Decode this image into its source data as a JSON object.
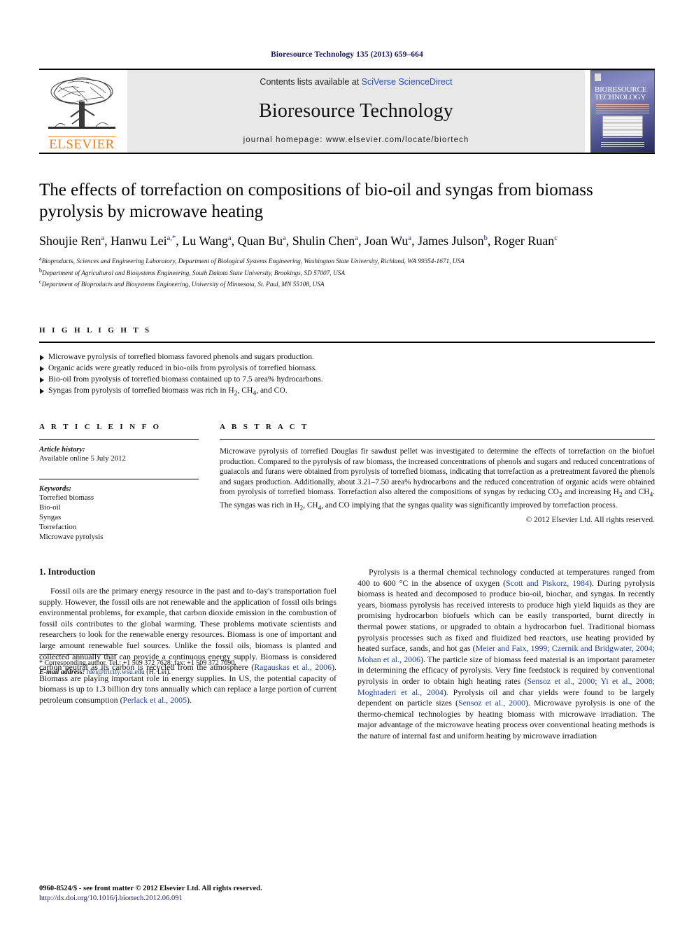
{
  "running_head": "Bioresource Technology 135 (2013) 659–664",
  "masthead": {
    "publisher_logo_text": "ELSEVIER",
    "contents_prefix": "Contents lists available at ",
    "contents_link": "SciVerse ScienceDirect",
    "journal_title": "Bioresource Technology",
    "homepage_line": "journal homepage: www.elsevier.com/locate/biortech",
    "cover_title_line1": "BIORESOURCE",
    "cover_title_line2": "TECHNOLOGY"
  },
  "article": {
    "title": "The effects of torrefaction on compositions of bio-oil and syngas from biomass pyrolysis by microwave heating",
    "authors": [
      {
        "name": "Shoujie Ren",
        "sup": "a"
      },
      {
        "name": "Hanwu Lei",
        "sup": "a,*"
      },
      {
        "name": "Lu Wang",
        "sup": "a"
      },
      {
        "name": "Quan Bu",
        "sup": "a"
      },
      {
        "name": "Shulin Chen",
        "sup": "a"
      },
      {
        "name": "Joan Wu",
        "sup": "a"
      },
      {
        "name": "James Julson",
        "sup": "b"
      },
      {
        "name": "Roger Ruan",
        "sup": "c"
      }
    ],
    "affiliations": [
      {
        "sup": "a",
        "text": "Bioproducts, Sciences and Engineering Laboratory, Department of Biological Systems Engineering, Washington State University, Richland, WA 99354-1671, USA"
      },
      {
        "sup": "b",
        "text": "Department of Agricultural and Biosystems Engineering, South Dakota State University, Brookings, SD 57007, USA"
      },
      {
        "sup": "c",
        "text": "Department of Bioproducts and Biosystems Engineering, University of Minnesota, St. Paul, MN 55108, USA"
      }
    ]
  },
  "highlights": {
    "label": "H I G H L I G H T S",
    "items": [
      "Microwave pyrolysis of torrefied biomass favored phenols and sugars production.",
      "Organic acids were greatly reduced in bio-oils from pyrolysis of torrefied biomass.",
      "Bio-oil from pyrolysis of torrefied biomass contained up to 7.5 area% hydrocarbons.",
      "Syngas from pyrolysis of torrefied biomass was rich in H2, CH4, and CO."
    ]
  },
  "article_info": {
    "label": "A R T I C L E    I N F O",
    "history_label": "Article history:",
    "history_value": "Available online 5 July 2012",
    "keywords_label": "Keywords:",
    "keywords": [
      "Torrefied biomass",
      "Bio-oil",
      "Syngas",
      "Torrefaction",
      "Microwave pyrolysis"
    ]
  },
  "abstract": {
    "label": "A B S T R A C T",
    "text": "Microwave pyrolysis of torrefied Douglas fir sawdust pellet was investigated to determine the effects of torrefaction on the biofuel production. Compared to the pyrolysis of raw biomass, the increased concentrations of phenols and sugars and reduced concentrations of guaiacols and furans were obtained from pyrolysis of torrefied biomass, indicating that torrefaction as a pretreatment favored the phenols and sugars production. Additionally, about 3.21–7.50 area% hydrocarbons and the reduced concentration of organic acids were obtained from pyrolysis of torrefied biomass. Torrefaction also altered the compositions of syngas by reducing CO2 and increasing H2 and CH4. The syngas was rich in H2, CH4, and CO implying that the syngas quality was significantly improved by torrefaction process.",
    "copyright": "© 2012 Elsevier Ltd. All rights reserved."
  },
  "introduction": {
    "heading": "1. Introduction",
    "left_paragraph_1_part1": "Fossil oils are the primary energy resource in the past and to-day's transportation fuel supply. However, the fossil oils are not renewable and the application of fossil oils brings environmental problems, for example, that carbon dioxide emission in the combustion of fossil oils contributes to the global warming. These problems motivate scientists and researchers to look for the renewable energy resources. Biomass is one of important and large amount renewable fuel sources. Unlike the fossil oils, biomass is planted and collected annually that can provide a continuous energy supply. Biomass is considered carbon neutral as its carbon is recycled from the atmosphere (",
    "left_ref_1": "Ragauskas et al., 2006",
    "left_paragraph_1_part2": "). Biomass are playing important role in energy supplies. In US, the potential capacity of biomass is up to 1.3 billion dry tons annually which can replace a large portion of current petroleum consumption (",
    "left_ref_2": "Perlack et al., 2005",
    "left_paragraph_1_part3": ").",
    "right_part1": "Pyrolysis is a thermal chemical technology conducted at temperatures ranged from 400 to 600 °C in the absence of oxygen (",
    "right_ref_1": "Scott and Piskorz, 1984",
    "right_part2": "). During pyrolysis biomass is heated and decomposed to produce bio-oil, biochar, and syngas. In recently years, biomass pyrolysis has received interests to produce high yield liquids as they are promising hydrocarbon biofuels which can be easily transported, burnt directly in thermal power stations, or upgraded to obtain a hydrocarbon fuel. Traditional biomass pyrolysis processes such as fixed and fluidized bed reactors, use heating provided by heated surface, sands, and hot gas (",
    "right_ref_2": "Meier and Faix, 1999; Czernik and Bridgwater, 2004; Mohan et al., 2006",
    "right_part3": "). The particle size of biomass feed material is an important parameter in determining the efficacy of pyrolysis. Very fine feedstock is required by conventional pyrolysis in order to obtain high heating rates (",
    "right_ref_3": "Sensoz et al., 2000; Yi et al., 2008; Moghtaderi et al., 2004",
    "right_part4": "). Pyrolysis oil and char yields were found to be largely dependent on particle sizes (",
    "right_ref_4": "Sensoz et al., 2000",
    "right_part5": "). Microwave pyrolysis is one of the thermo-chemical technologies by heating biomass with microwave irradiation. The major advantage of the microwave heating process over conventional heating methods is the nature of internal fast and uniform heating by microwave irradiation"
  },
  "footnote": {
    "corresponding": "* Corresponding author. Tel.: +1 509 372 7628; fax: +1 509 372 7690.",
    "email_label": "E-mail address:",
    "email": "hlei@tricity.wsu.edu",
    "email_suffix": "(H. Lei)."
  },
  "imprint": {
    "front_matter": "0960-8524/$ - see front matter © 2012 Elsevier Ltd. All rights reserved.",
    "doi": "http://dx.doi.org/10.1016/j.biortech.2012.06.091"
  }
}
